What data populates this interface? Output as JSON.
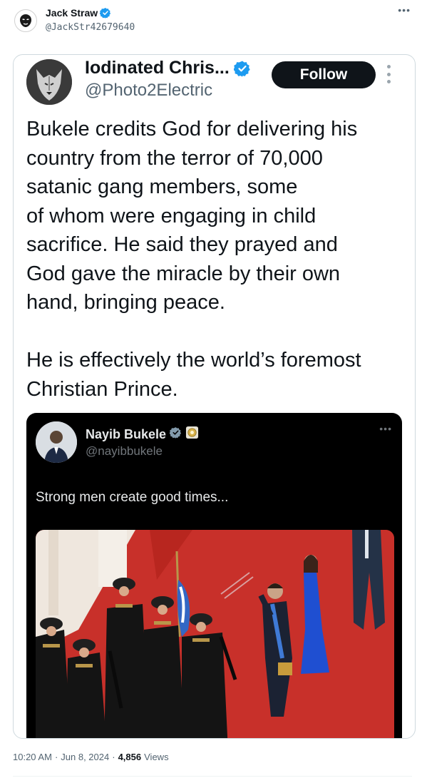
{
  "author": {
    "name": "Jack Straw",
    "handle": "@JackStr42679640",
    "more_icon": "more-horizontal-icon"
  },
  "quoted_post": {
    "name": "Iodinated Chris...",
    "handle": "@Photo2Electric",
    "follow_label": "Follow",
    "text": "Bukele credits God for delivering his\ncountry from the terror of 70,000\nsatanic gang members, some\nof whom were engaging in child\nsacrifice. He said they prayed and\nGod gave the miracle by their own\nhand, bringing peace.\n\nHe is effectively the world’s foremost\nChristian Prince."
  },
  "embedded_post": {
    "name": "Nayib Bukele",
    "handle": "@nayibbukele",
    "text": "Strong men create good times...",
    "more_icon": "more-horizontal-icon"
  },
  "meta": {
    "time": "10:20 AM",
    "date": "Jun 8, 2024",
    "views_count": "4,856",
    "views_label": "Views"
  },
  "colors": {
    "verified_blue": "#1d9bf0",
    "follow_bg": "#0f1419",
    "carpet_red": "#c62a22",
    "dark_bg": "#000000"
  }
}
